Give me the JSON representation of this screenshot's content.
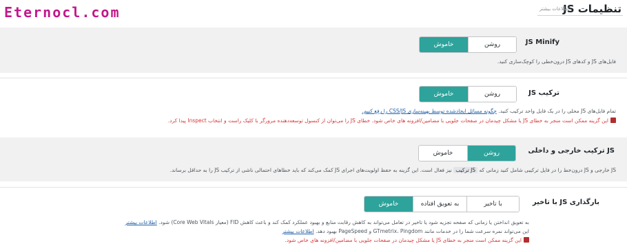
{
  "brand": "Eternocl.com",
  "header": {
    "title": "تنظیمات JS",
    "subtitle": "اطلاعات بیشتر"
  },
  "minify": {
    "label": "JS Minify",
    "options": [
      "روشن",
      "خاموش"
    ],
    "active": "خاموش",
    "desc": "فایل‌های JS و کدهای JS درون‌خطی را کوچک‌سازی کنید."
  },
  "combine": {
    "label": "ترکیب JS",
    "options": [
      "روشن",
      "خاموش"
    ],
    "active": "خاموش",
    "desc": "تمام فایل‌های JS محلی را در یک فایل واحد ترکیب کنید.",
    "link": "چگونه مسائل ایجادشده توسط بهینه‌سازی CSS/JS را رفع کنیم.",
    "warn": "این گزینه ممکن است منجر به خطای JS یا مشکل چیدمان در صفحات جلویی با مضامین/افزونه های خاص شود. خطای JS را می‌توان از کنسول توسعه‌دهنده مرورگر با کلیک راست و انتخاب Inspect پیدا کرد."
  },
  "combine_ext": {
    "label": "JS ترکیب خارجی و داخلی",
    "options": [
      "روشن",
      "خاموش"
    ],
    "active": "روشن",
    "desc_a": "JS خارجی و JS درون‌خط را در فایل ترکیبی شامل کنید زمانی که",
    "code": "JS ترکیب",
    "desc_b": "نیز فعال است. این گزینه به حفظ اولویت‌های اجرای JS کمک می‌کند که باید خطاهای احتمالی ناشی از ترکیب JS را به حداقل برساند."
  },
  "defer": {
    "label": "بارگذاری JS با تاخیر",
    "options": [
      "با تاخیر",
      "به تعویق افتاده",
      "خاموش"
    ],
    "active": "خاموش",
    "desc1": "به تعویق انداختن یا زمانی که صفحه تجزیه شود یا تاخیر در تعامل می‌تواند به کاهش رقابت منابع و بهبود عملکرد کمک کند و باعث کاهش FID (معیار Core Web Vitals) شود.",
    "link1": "اطلاعات بیشتر",
    "desc2": "این می‌تواند نمره سرعت شما را در خدمات مانند GTmetrix، Pingdom و PageSpeed بهبود دهد.",
    "link2": "اطلاعات بیشتر",
    "warn": "این گزینه ممکن است منجر به خطای JS یا مشکل چیدمان در صفحات جلویی با مضامین/افزونه های خاص شود."
  },
  "colors": {
    "accent": "#2da39b",
    "warning": "#d63638",
    "brand": "#c2188a"
  }
}
